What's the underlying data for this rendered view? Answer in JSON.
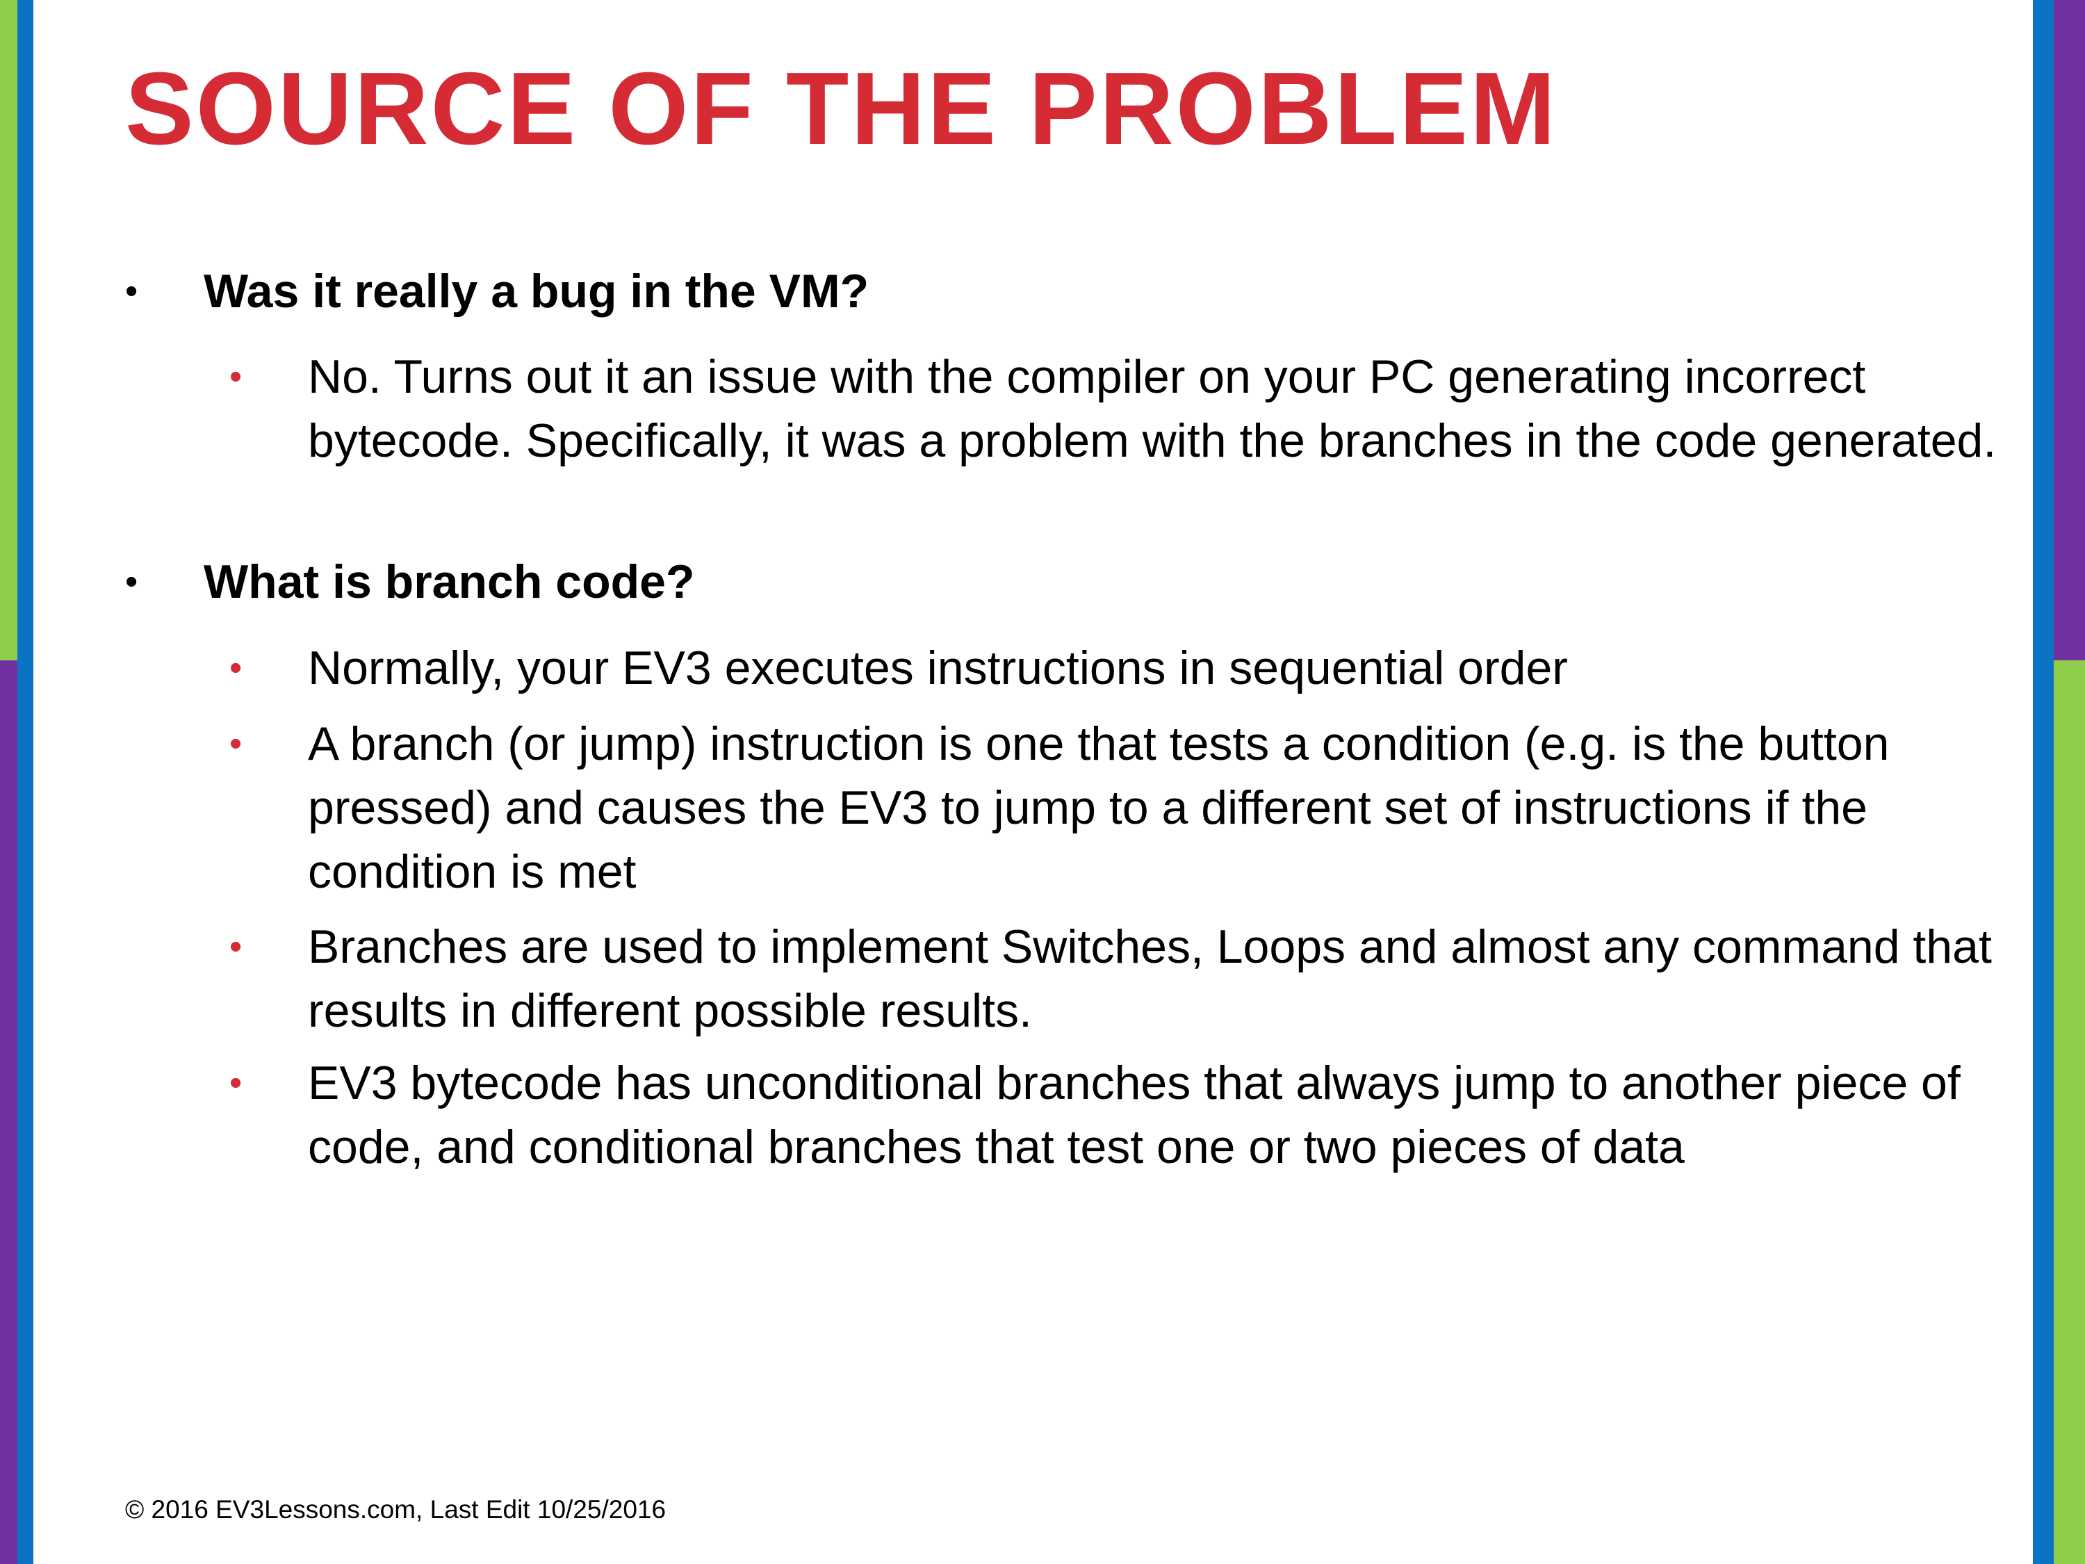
{
  "colors": {
    "title": "#d52b35",
    "sub_bullet": "#d52b35",
    "green": "#8fce4a",
    "purple": "#7231a0",
    "blue": "#0c72c3"
  },
  "slide": {
    "title": "SOURCE OF THE PROBLEM",
    "bullet_char": "•",
    "items": [
      {
        "level": 1,
        "text": "Was it really a bug in the VM?"
      },
      {
        "level": 2,
        "text": "No. Turns out it an issue with the compiler on your PC generating incorrect bytecode. Specifically, it was a problem with the branches in the code generated."
      },
      {
        "level": 1,
        "text": "What is branch code?"
      },
      {
        "level": 2,
        "text": "Normally, your EV3 executes instructions in sequential order"
      },
      {
        "level": 2,
        "text": "A branch (or jump) instruction is one that tests a condition (e.g. is the button pressed) and causes the EV3 to jump to a different set of instructions if the condition is met"
      },
      {
        "level": 2,
        "text": "Branches are used to implement Switches, Loops and almost any command that results in different possible results."
      },
      {
        "level": 2,
        "text": "EV3 bytecode has unconditional branches that always jump to another piece of code, and conditional branches that test one or two pieces of data"
      }
    ],
    "footer": "© 2016 EV3Lessons.com, Last Edit 10/25/2016"
  }
}
